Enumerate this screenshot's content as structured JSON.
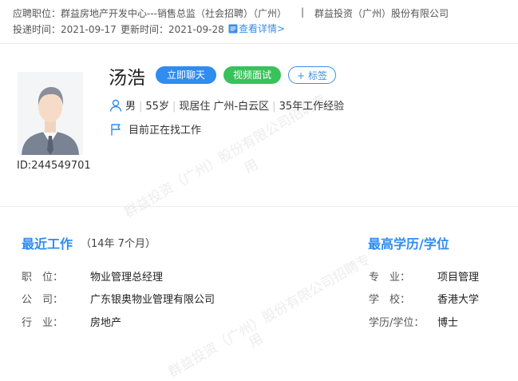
{
  "job": {
    "position_label": "应聘职位：",
    "position": "群益房地产开发中心---销售总监（社会招聘）（广州）",
    "separator": "|",
    "company": "群益投资（广州）股份有限公司",
    "applied_label": "投递时间：",
    "applied_date": "2021-09-17",
    "updated_label": "更新时间：",
    "updated_date": "2021-09-28",
    "detail_link": "查看详情>"
  },
  "candidate": {
    "name": "汤浩",
    "id": "ID:244549701",
    "gender": "男",
    "age": "55岁",
    "location": "现居住 广州-白云区",
    "experience": "35年工作经验",
    "status": "目前正在找工作"
  },
  "actions": {
    "chat": "立即聊天",
    "video": "视频面试",
    "tag": "标签"
  },
  "recent_work": {
    "title": "最近工作",
    "duration": "（14年 7个月）",
    "rows": [
      {
        "label": "职　位：",
        "value": "物业管理总经理"
      },
      {
        "label": "公　司：",
        "value": "广东银奥物业管理有限公司"
      },
      {
        "label": "行　业：",
        "value": "房地产"
      }
    ]
  },
  "education": {
    "title": "最高学历/学位",
    "rows": [
      {
        "label": "专　业：",
        "value": "项目管理"
      },
      {
        "label": "学　校：",
        "value": "香港大学"
      },
      {
        "label": "学历/学位：",
        "value": "博士"
      }
    ]
  },
  "watermark": {
    "line1": "群益投资（广州）股份有限公司招聘专",
    "line2": "用"
  },
  "colors": {
    "accent_blue": "#2f8cf0",
    "accent_green": "#39c15b"
  }
}
